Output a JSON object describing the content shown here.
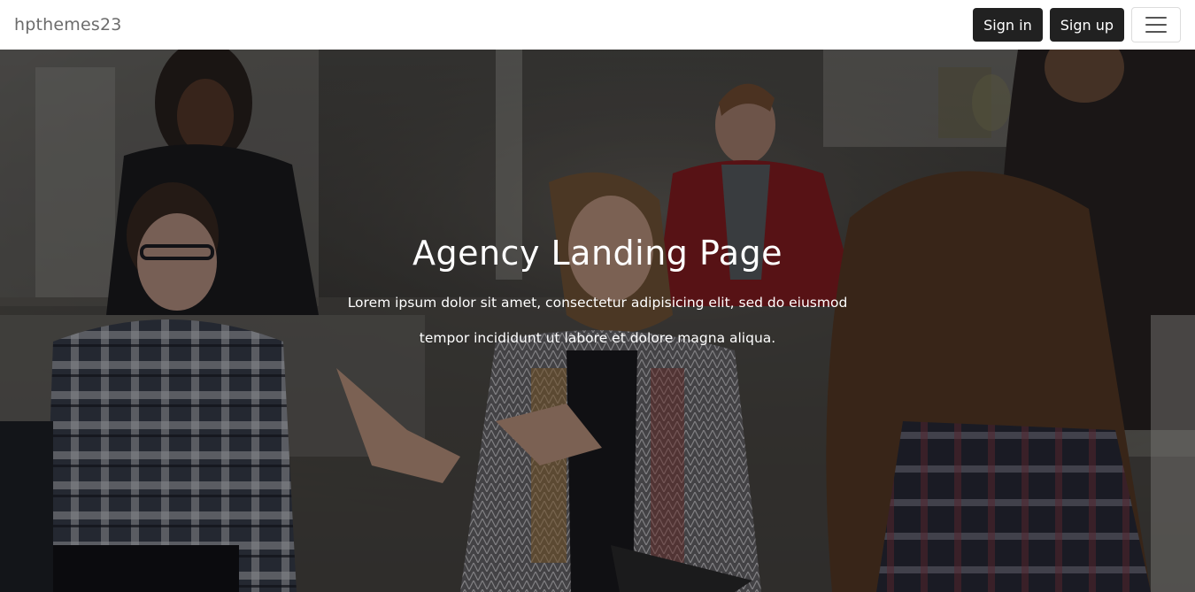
{
  "navbar": {
    "brand": "hpthemes23",
    "sign_in_label": "Sign in",
    "sign_up_label": "Sign up",
    "toggler_icon": "hamburger-icon"
  },
  "hero": {
    "title": "Agency Landing Page",
    "line_1": "Lorem ipsum dolor sit amet, consectetur adipisicing elit, sed do eiusmod",
    "line_2": "tempor incididunt ut labore et dolore magna aliqua."
  },
  "colors": {
    "navbar_bg": "#ffffff",
    "button_bg": "#212121",
    "brand_text": "#6c6c6c",
    "hero_text": "#ffffff"
  }
}
